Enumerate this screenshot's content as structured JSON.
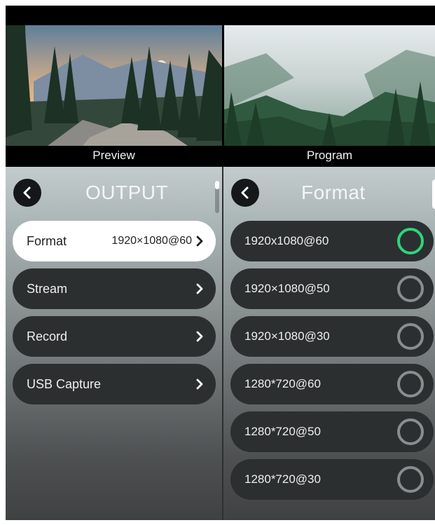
{
  "preview": {
    "label": "Preview"
  },
  "program": {
    "label": "Program"
  },
  "output_panel": {
    "title": "OUTPUT",
    "items": [
      {
        "label": "Format",
        "value": "1920×1080@60",
        "selected": true
      },
      {
        "label": "Stream",
        "value": ""
      },
      {
        "label": "Record",
        "value": ""
      },
      {
        "label": "USB Capture",
        "value": ""
      }
    ]
  },
  "format_panel": {
    "title": "Format",
    "options": [
      {
        "label": "1920x1080@60",
        "selected": true
      },
      {
        "label": "1920×1080@50",
        "selected": false
      },
      {
        "label": "1920×1080@30",
        "selected": false
      },
      {
        "label": "1280*720@60",
        "selected": false
      },
      {
        "label": "1280*720@50",
        "selected": false
      },
      {
        "label": "1280*720@30",
        "selected": false
      }
    ]
  },
  "icons": {
    "back": "chevron-left-icon",
    "forward": "chevron-right-icon",
    "radio_on": "radio-selected-icon",
    "radio_off": "radio-unselected-icon"
  },
  "colors": {
    "radio_selected": "#2ed47d",
    "radio_unselected": "#8a8d8f",
    "row_background": "#2c2f30",
    "row_selected_background": "#ffffff"
  }
}
